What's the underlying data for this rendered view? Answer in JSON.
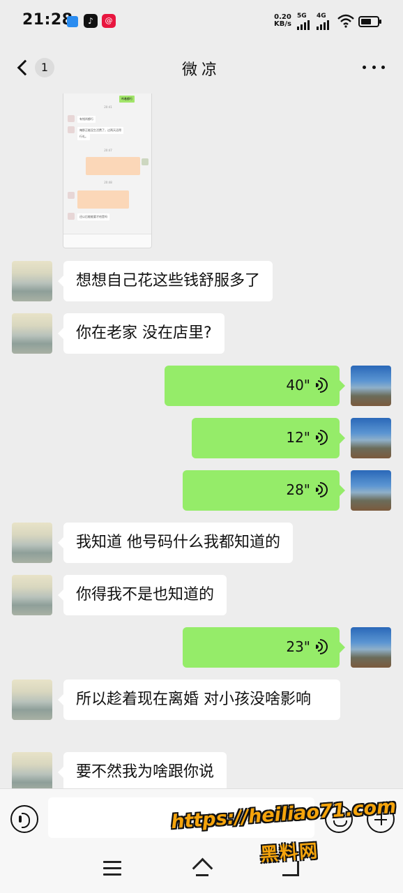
{
  "status_bar": {
    "time": "21:28",
    "net_speed_value": "0.20",
    "net_speed_unit": "KB/s",
    "signal_1": "5G",
    "signal_2": "4G",
    "app_icon_2": "♪",
    "app_icon_3": "@"
  },
  "header": {
    "title": "微凉",
    "unread_count": "1"
  },
  "messages": [
    {
      "side": "left",
      "type": "text",
      "text": "想想自己花这些钱舒服多了"
    },
    {
      "side": "left",
      "type": "text",
      "text": "你在老家  没在店里?"
    },
    {
      "side": "right",
      "type": "voice",
      "duration": "40\""
    },
    {
      "side": "right",
      "type": "voice",
      "duration": "12\""
    },
    {
      "side": "right",
      "type": "voice",
      "duration": "28\""
    },
    {
      "side": "left",
      "type": "text",
      "text": "我知道  他号码什么我都知道的"
    },
    {
      "side": "left",
      "type": "text",
      "text": "你得我不是也知道的"
    },
    {
      "side": "right",
      "type": "voice",
      "duration": "23\""
    },
    {
      "side": "left",
      "type": "text",
      "text": "所以趁着现在离婚  对小孩没啥影响"
    },
    {
      "side": "left",
      "type": "text",
      "text": "要不然我为啥跟你说"
    }
  ],
  "screenshot_image": {
    "line_1": "有钱尚都行",
    "line_2": "俺那正能没生活费了，过两天还得",
    "line_3": "行礼。",
    "line_4": "还以后能能要才给是吗",
    "green_1": "咋着都行"
  },
  "watermark": {
    "url": "https://heiliao71.com",
    "name": "黑料网"
  },
  "colors": {
    "background": "#ededed",
    "outgoing_bubble": "#95ec69",
    "incoming_bubble": "#ffffff",
    "watermark": "#f5a40c"
  },
  "icons": {
    "back": "chevron-left-icon",
    "more": "more-dots-icon",
    "voice_input": "voice-input-icon",
    "emoji": "emoji-icon",
    "plus": "plus-icon",
    "voice_wave": "voice-wave-icon"
  }
}
